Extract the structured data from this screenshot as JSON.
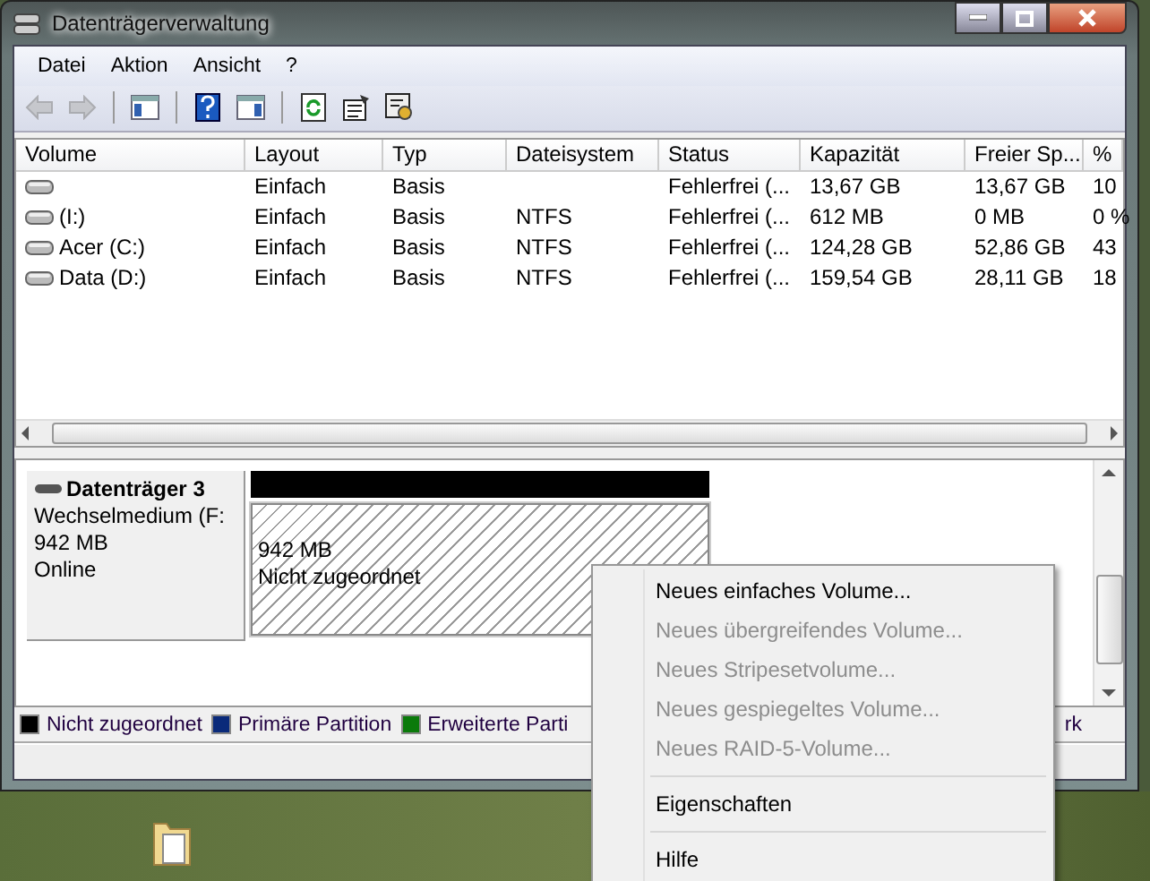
{
  "window": {
    "title": "Datenträgerverwaltung"
  },
  "menu": [
    "Datei",
    "Aktion",
    "Ansicht",
    "?"
  ],
  "toolbar": [
    {
      "kind": "back",
      "disabled": true
    },
    {
      "kind": "forward",
      "disabled": true
    },
    {
      "kind": "separator"
    },
    {
      "kind": "tree"
    },
    {
      "kind": "separator"
    },
    {
      "kind": "help"
    },
    {
      "kind": "pane"
    },
    {
      "kind": "separator"
    },
    {
      "kind": "refresh"
    },
    {
      "kind": "properties"
    },
    {
      "kind": "wizard"
    }
  ],
  "volumes": {
    "columns": [
      "Volume",
      "Layout",
      "Typ",
      "Dateisystem",
      "Status",
      "Kapazität",
      "Freier Sp...",
      "%"
    ],
    "rows": [
      {
        "cells": [
          "",
          "Einfach",
          "Basis",
          "",
          "Fehlerfrei (...",
          "13,67 GB",
          "13,67 GB",
          "10"
        ]
      },
      {
        "cells": [
          "(I:)",
          "Einfach",
          "Basis",
          "NTFS",
          "Fehlerfrei (...",
          "612 MB",
          "0 MB",
          "0 %"
        ]
      },
      {
        "cells": [
          "Acer (C:)",
          "Einfach",
          "Basis",
          "NTFS",
          "Fehlerfrei (...",
          "124,28 GB",
          "52,86 GB",
          "43"
        ]
      },
      {
        "cells": [
          "Data (D:)",
          "Einfach",
          "Basis",
          "NTFS",
          "Fehlerfrei (...",
          "159,54 GB",
          "28,11 GB",
          "18"
        ]
      }
    ]
  },
  "disk": {
    "title": "Datenträger 3",
    "type": "Wechselmedium (F:",
    "size": "942 MB",
    "status": "Online",
    "partition": {
      "size": "942 MB",
      "label": "Nicht zugeordnet",
      "color": "#000000"
    }
  },
  "legend": [
    {
      "label": "Nicht zugeordnet",
      "color": "#000000"
    },
    {
      "label": "Primäre Partition",
      "color": "#0a2a7a"
    },
    {
      "label": "Erweiterte Parti",
      "color": "#0a7a0a"
    }
  ],
  "legend_fragment": "rk",
  "context_menu": {
    "items": [
      {
        "kind": "item",
        "label": "Neues einfaches Volume...",
        "disabled": false
      },
      {
        "kind": "item",
        "label": "Neues übergreifendes Volume...",
        "disabled": true
      },
      {
        "kind": "item",
        "label": "Neues Stripesetvolume...",
        "disabled": true
      },
      {
        "kind": "item",
        "label": "Neues gespiegeltes Volume...",
        "disabled": true
      },
      {
        "kind": "item",
        "label": "Neues RAID-5-Volume...",
        "disabled": true
      },
      {
        "kind": "separator"
      },
      {
        "kind": "item",
        "label": "Eigenschaften",
        "disabled": false
      },
      {
        "kind": "separator"
      },
      {
        "kind": "item",
        "label": "Hilfe",
        "disabled": false
      }
    ]
  }
}
